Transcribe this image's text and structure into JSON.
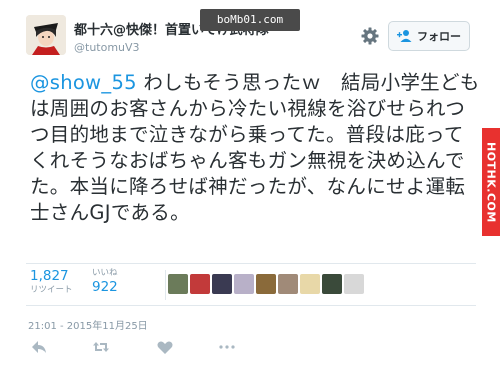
{
  "header": {
    "display_name": "都十六@快傑！首置いてけ武将隊",
    "handle": "@tutomuV3",
    "follow_label": "フォロー",
    "watermark_top": "boMb01.com"
  },
  "tweet": {
    "mention": "@show_55",
    "text": " わしもそう思ったｗ　結局小学生どもは周囲のお客さんから冷たい視線を浴びせられつつ目的地まで泣きながら乗ってた。普段は庇ってくれそうなおばちゃん客もガン無視を決め込んでた。本当に降ろせば神だったが、なんにせよ運転士さんGJである。"
  },
  "side_watermark": "HOTHK.COM",
  "stats": {
    "retweets_count": "1,827",
    "retweets_label": "リツイート",
    "likes_count": "922",
    "likes_label": "いいね"
  },
  "likers": [
    {
      "icon": "liker-avatar",
      "color": "#6b7b5a"
    },
    {
      "icon": "liker-avatar",
      "color": "#c23a3a"
    },
    {
      "icon": "liker-avatar",
      "color": "#3a3a52"
    },
    {
      "icon": "liker-avatar",
      "color": "#b8b0c8"
    },
    {
      "icon": "liker-avatar",
      "color": "#8a6a3a"
    },
    {
      "icon": "liker-avatar",
      "color": "#a08a78"
    },
    {
      "icon": "liker-avatar",
      "color": "#e8d8a8"
    },
    {
      "icon": "liker-avatar",
      "color": "#3a4a3a"
    },
    {
      "icon": "liker-avatar",
      "color": "#d8d8d8"
    }
  ],
  "timestamp": "21:01 - 2015年11月25日",
  "actions": [
    "reply-icon",
    "retweet-icon",
    "like-icon",
    "more-icon"
  ],
  "colors": {
    "link": "#1b95e0",
    "text": "#292f33",
    "muted": "#8899a6",
    "border": "#e1e8ed",
    "watermark_red": "#e8312f"
  }
}
